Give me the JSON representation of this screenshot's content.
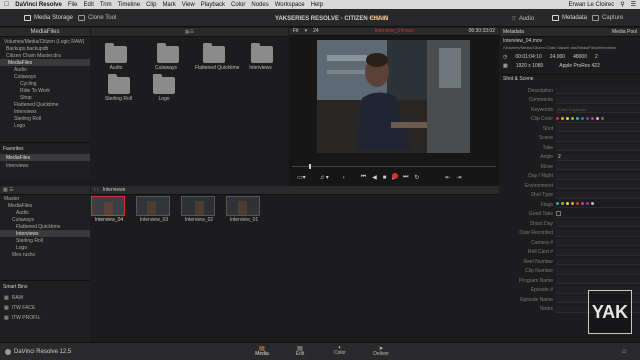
{
  "menubar": {
    "apple": "",
    "items": [
      "DaVinci Resolve",
      "File",
      "Edit",
      "Trim",
      "Timeline",
      "Clip",
      "Mark",
      "View",
      "Playback",
      "Color",
      "Nodes",
      "Workspace",
      "Help"
    ],
    "center": "YAKSERIES RESOLVE - CITIZEN CHAIN",
    "user": "Erwan Le Cloirec"
  },
  "toolbar": {
    "media_storage": "Media Storage",
    "clone_tool": "Clone Tool",
    "project": "YAKSERIES RESOLVE - CITIZEN CHAIN",
    "edited": "Edited",
    "audio": "Audio",
    "metadata": "Metadata",
    "capture": "Capture"
  },
  "storage": {
    "header": "MediaFiles",
    "tree": [
      "Volumes/Media/Citizen (Logic RAW)",
      "Backups.backupdb",
      "Citizen Chain Master.dra",
      "MediaFiles",
      "Audio",
      "Cutaways",
      "Cycling",
      "Ride To Work",
      "Shop",
      "Flattened Quicktime",
      "Interviews",
      "Sterling Roll",
      "Logo"
    ],
    "folders": [
      "Audio",
      "Cutaways",
      "Flattened Quicktime",
      "Interviews",
      "Sterling Roll",
      "Logo"
    ],
    "favorites_label": "Favorites",
    "favorites": [
      "MediaFiles",
      "Interviews"
    ]
  },
  "viewer": {
    "fit": "Fit",
    "frame": "24",
    "clip_name": "Interview_04.mov",
    "timecode": "06:30:33:02"
  },
  "mediapool": {
    "header": "Interviews",
    "tree": [
      "Master",
      "MediaFiles",
      "Audio",
      "Cutaways",
      "Flattened Quicktime",
      "Interviews",
      "Sterling Roll",
      "Logo",
      "Mes rushs"
    ],
    "clips": [
      "Interview_04",
      "Interview_03",
      "Interview_02",
      "Interview_01"
    ],
    "smart_bins_label": "Smart Bins",
    "smart_bins": [
      "RAW",
      "ITW FACE",
      "ITW PROFIL"
    ]
  },
  "metadata": {
    "header": "Metadata",
    "header_right": "Media Pool",
    "filename": "Interview_04.mov",
    "path": "/Volumes/Media/Citizen Chain Master.dra/MediaFiles/Interviews",
    "tc_start": "00:01:04:10",
    "fps": "24.000",
    "sample": "48000",
    "ch": "2",
    "res": "1920 x 1080",
    "codec": "Apple ProRes 422",
    "group": "Shot & Scene",
    "fields": [
      "Description",
      "Comments",
      "Keywords",
      "Clip Color",
      "Shot",
      "Scene",
      "Take",
      "Angle",
      "Move",
      "Day / Night",
      "Environment",
      "Shot Type",
      "Flags",
      "Good Take",
      "Shoot Day",
      "Date Recorded",
      "Camera #",
      "Roll Card #",
      "Reel Number",
      "Clip Number",
      "Program Name",
      "Episode #",
      "Episode Name",
      "Notes"
    ],
    "keywords_placeholder": "Enter Keywords",
    "angle_value": "2"
  },
  "watermark": "YAK",
  "bottombar": {
    "app": "DaVinci Resolve 12.5",
    "tabs": [
      "Media",
      "Edit",
      "Color",
      "Deliver"
    ]
  },
  "colors": {
    "accent_orange": "#e9a23b",
    "record_red": "#d23434",
    "selected_border": "#d23434"
  }
}
